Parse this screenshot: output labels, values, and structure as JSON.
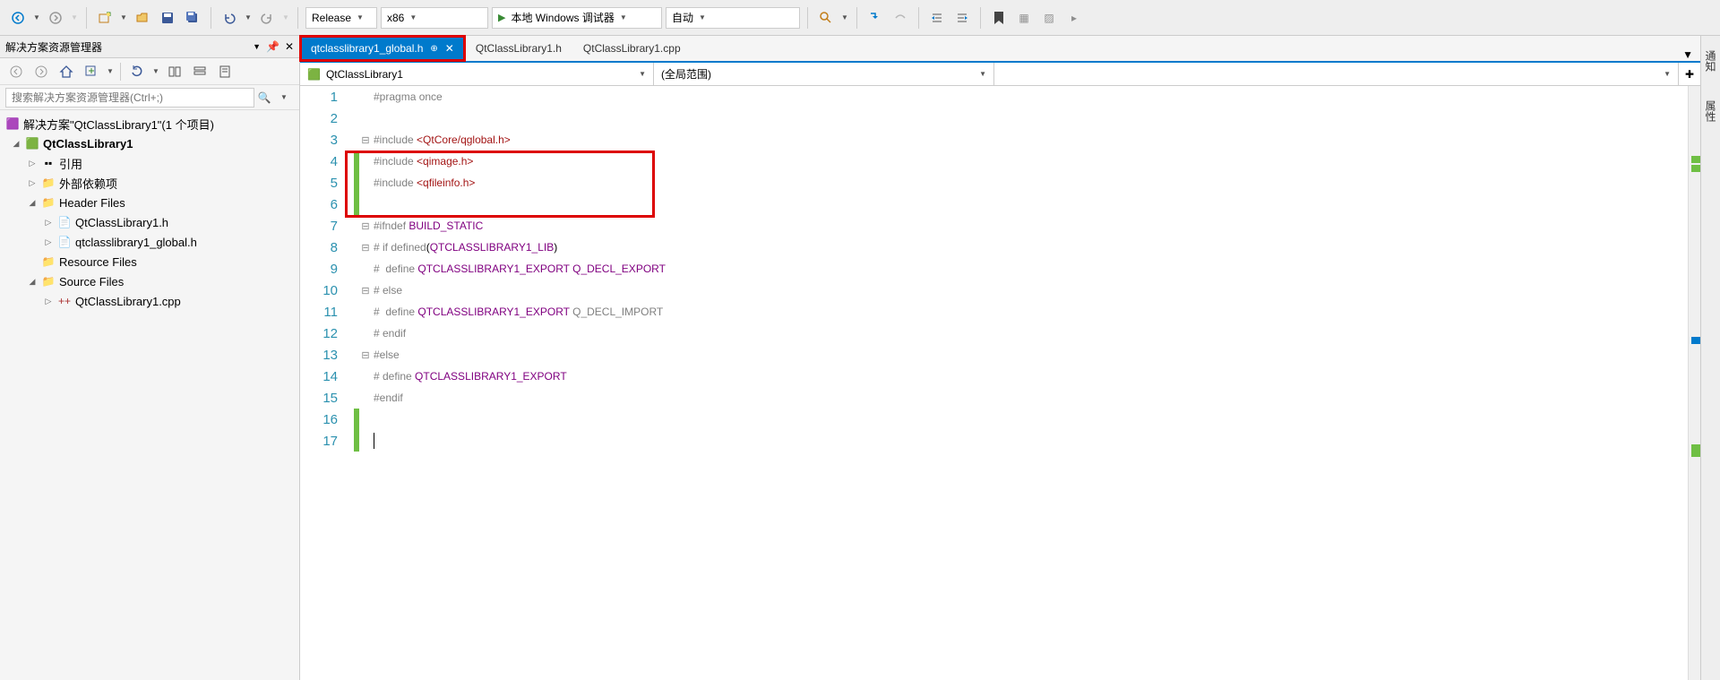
{
  "toolbar": {
    "config": "Release",
    "platform": "x86",
    "debug_label": "本地 Windows 调试器",
    "auto_label": "自动"
  },
  "explorer": {
    "title": "解决方案资源管理器",
    "search_placeholder": "搜索解决方案资源管理器(Ctrl+;)",
    "solution_label": "解决方案\"QtClassLibrary1\"(1 个项目)",
    "project": "QtClassLibrary1",
    "nodes": {
      "references": "引用",
      "external": "外部依赖项",
      "headers": "Header Files",
      "header1": "QtClassLibrary1.h",
      "header2": "qtclasslibrary1_global.h",
      "resources": "Resource Files",
      "sources": "Source Files",
      "source1": "QtClassLibrary1.cpp"
    }
  },
  "tabs": {
    "active": "qtclasslibrary1_global.h",
    "tab2": "QtClassLibrary1.h",
    "tab3": "QtClassLibrary1.cpp"
  },
  "nav": {
    "scope": "QtClassLibrary1",
    "scope2": "(全局范围)"
  },
  "right_tabs": {
    "t1": "通知",
    "t2": "属性"
  },
  "code": {
    "l1": "#pragma once",
    "l3a": "#include ",
    "l3b": "<QtCore/qglobal.h>",
    "l4a": "#include ",
    "l4b": "<qimage.h>",
    "l5a": "#include ",
    "l5b": "<qfileinfo.h>",
    "l7a": "#ifndef ",
    "l7b": "BUILD_STATIC",
    "l8a": "# if defined",
    "l8b": "(",
    "l8c": "QTCLASSLIBRARY1_LIB",
    "l8d": ")",
    "l9a": "#  define ",
    "l9b": "QTCLASSLIBRARY1_EXPORT",
    "l9c": " Q_DECL_EXPORT",
    "l10": "# else",
    "l11a": "#  define ",
    "l11b": "QTCLASSLIBRARY1_EXPORT",
    "l11c": " Q_DECL_IMPORT",
    "l12": "# endif",
    "l13": "#else",
    "l14a": "# define ",
    "l14b": "QTCLASSLIBRARY1_EXPORT",
    "l15": "#endif"
  },
  "line_numbers": [
    "1",
    "2",
    "3",
    "4",
    "5",
    "6",
    "7",
    "8",
    "9",
    "10",
    "11",
    "12",
    "13",
    "14",
    "15",
    "16",
    "17"
  ]
}
